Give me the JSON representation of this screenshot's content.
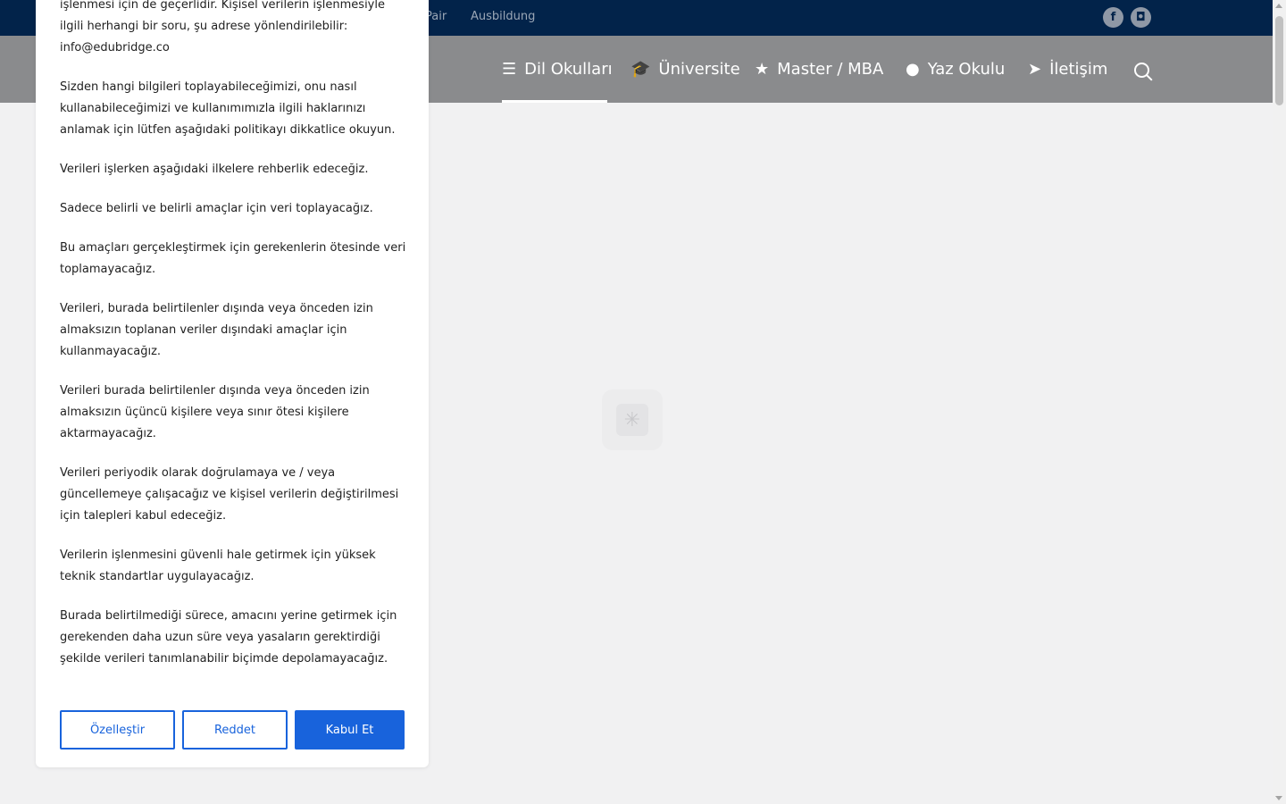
{
  "topbar": {
    "links": [
      "Pair",
      "Ausbildung"
    ],
    "social": [
      {
        "icon": "facebook-icon",
        "glyph": "f"
      },
      {
        "icon": "instagram-icon",
        "glyph": "◘"
      }
    ]
  },
  "nav": {
    "items": [
      {
        "label": "Dil Okulları",
        "icon": "stack-icon",
        "glyph": "☰",
        "active": true
      },
      {
        "label": "Üniversite",
        "icon": "graduation-cap-icon",
        "glyph": "🎓",
        "active": false
      },
      {
        "label": "Master / MBA",
        "icon": "star-icon",
        "glyph": "★",
        "active": false
      },
      {
        "label": "Yaz Okulu",
        "icon": "globe-icon",
        "glyph": "●",
        "active": false
      },
      {
        "label": "İletişim",
        "icon": "paper-plane-icon",
        "glyph": "➤",
        "active": false
      }
    ]
  },
  "modal": {
    "paragraphs": [
      "işlenmesi için de geçerlidir. Kişisel verilerin işlenmesiyle ilgili herhangi bir soru, şu adrese yönlendirilebilir: info@edubridge.co",
      "Sizden hangi bilgileri toplayabileceğimizi, onu nasıl kullanabileceğimizi ve kullanımımızla ilgili haklarınızı anlamak için lütfen aşağıdaki politikayı dikkatlice okuyun.",
      "Verileri işlerken aşağıdaki ilkelere rehberlik edeceğiz.",
      "Sadece belirli ve belirli amaçlar için veri toplayacağız.",
      "Bu amaçları gerçekleştirmek için gerekenlerin ötesinde veri toplamayacağız.",
      "Verileri, burada belirtilenler dışında veya önceden izin almaksızın toplanan veriler dışındaki amaçlar için kullanmayacağız.",
      "Verileri burada belirtilenler dışında veya önceden izin almaksızın üçüncü kişilere veya sınır ötesi kişilere aktarmayacağız.",
      "Verileri periyodik olarak doğrulamaya ve / veya güncellemeye çalışacağız ve kişisel verilerin değiştirilmesi için talepleri kabul edeceğiz.",
      "Verilerin işlenmesini güvenli hale getirmek için yüksek teknik standartlar uygulayacağız.",
      "Burada belirtilmediği sürece, amacını yerine getirmek için gerekenden daha uzun süre veya yasaların gerektirdiği şekilde verileri tanımlanabilir biçimde depolamayacağız."
    ],
    "customize_label": "Özelleştir",
    "reject_label": "Reddet",
    "accept_label": "Kabul Et"
  },
  "colors": {
    "topbar": "#02234a",
    "navbar": "#8a8b8d",
    "accent": "#1863dc"
  }
}
